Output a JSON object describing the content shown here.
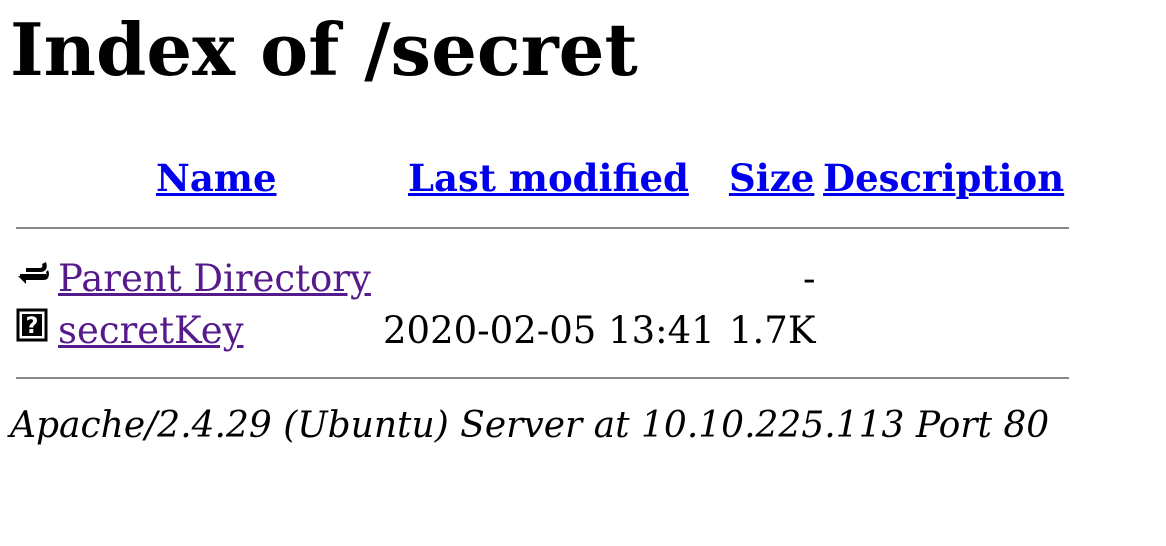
{
  "page": {
    "title": "Index of /secret"
  },
  "columns": {
    "name": "Name",
    "last_modified": "Last modified",
    "size": "Size",
    "description": "Description"
  },
  "rows": [
    {
      "icon": "back-icon",
      "name": "Parent Directory",
      "last_modified": "",
      "size": "-",
      "description": ""
    },
    {
      "icon": "unknown-file-icon",
      "name": "secretKey",
      "last_modified": "2020-02-05 13:41",
      "size": "1.7K",
      "description": ""
    }
  ],
  "footer": {
    "address": "Apache/2.4.29 (Ubuntu) Server at 10.10.225.113 Port 80"
  },
  "colors": {
    "link": "#0000ee",
    "visited_link": "#551a8b",
    "rule": "#888888"
  }
}
